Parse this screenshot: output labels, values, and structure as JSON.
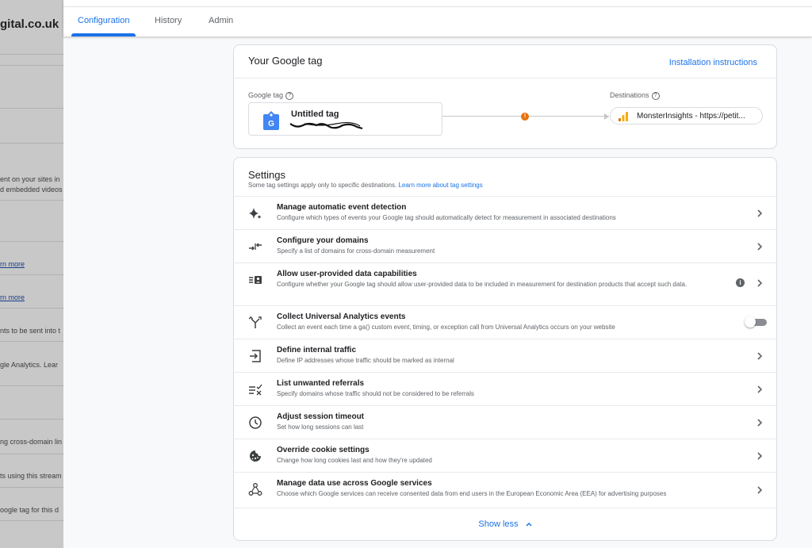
{
  "background": {
    "site_title": "gital.co.uk",
    "snippets": [
      "ent on your sites in",
      "d embedded videos",
      "rn more",
      "rn more",
      "nts to be sent into t",
      "gle Analytics. Lear",
      "ng cross-domain lin",
      "ts using this stream",
      "oogle tag for this d"
    ]
  },
  "tabs": [
    {
      "label": "Configuration"
    },
    {
      "label": "History"
    },
    {
      "label": "Admin"
    }
  ],
  "tag_card": {
    "title": "Your Google tag",
    "install_link": "Installation instructions",
    "google_tag_label": "Google tag",
    "tag_name": "Untitled tag",
    "destinations_label": "Destinations",
    "destination": "MonsterInsights - https://petit...",
    "warning_glyph": "!"
  },
  "settings": {
    "title": "Settings",
    "subtitle": "Some tag settings apply only to specific destinations.",
    "subtitle_link": "Learn more about tag settings",
    "rows": [
      {
        "icon": "sparkle-icon",
        "title": "Manage automatic event detection",
        "desc": "Configure which types of events your Google tag should automatically detect for measurement in associated destinations"
      },
      {
        "icon": "domains-arrows-icon",
        "title": "Configure your domains",
        "desc": "Specify a list of domains for cross-domain measurement"
      },
      {
        "icon": "user-data-icon",
        "title": "Allow user-provided data capabilities",
        "desc": "Configure whether your Google tag should allow user-provided data to be included in measurement for destination products that accept such data."
      },
      {
        "icon": "fork-icon",
        "title": "Collect Universal Analytics events",
        "desc": "Collect an event each time a ga() custom event, timing, or exception call from Universal Analytics occurs on your website"
      },
      {
        "icon": "login-arrow-icon",
        "title": "Define internal traffic",
        "desc": "Define IP addresses whose traffic should be marked as internal"
      },
      {
        "icon": "list-check-icon",
        "title": "List unwanted referrals",
        "desc": "Specify domains whose traffic should not be considered to be referrals"
      },
      {
        "icon": "clock-icon",
        "title": "Adjust session timeout",
        "desc": "Set how long sessions can last"
      },
      {
        "icon": "cookie-icon",
        "title": "Override cookie settings",
        "desc": "Change how long cookies last and how they're updated"
      },
      {
        "icon": "share-nodes-icon",
        "title": "Manage data use across Google services",
        "desc": "Choose which Google services can receive consented data from end users in the European Economic Area (EEA) for advertising purposes"
      }
    ],
    "show_less": "Show less"
  },
  "colors": {
    "accent": "#1a73e8",
    "warning": "#e8710a",
    "analytics_orange": "#f9ab00"
  }
}
